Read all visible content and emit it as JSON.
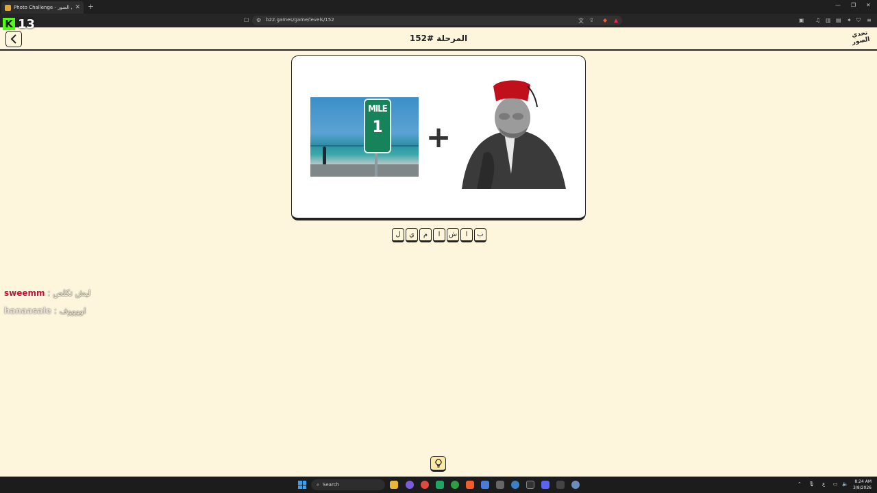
{
  "browser": {
    "tab_title": "Photo Challenge - تحدي الصور",
    "url": "b22.games/game/levels/152"
  },
  "overlay": {
    "kick_count": "13"
  },
  "header": {
    "back_icon": "chevron-left-icon",
    "level_title": "المرحلة #152",
    "logo_text": "تحدي الصور"
  },
  "puzzle": {
    "left_image": "mile-1-sign-beach-photo",
    "left_sign_top": "MILE",
    "left_sign_num": "1",
    "operator": "+",
    "right_image": "man-in-red-fez-photo"
  },
  "answer": {
    "letters": [
      "ب",
      "ا",
      "ش",
      "ا",
      "م",
      "ي",
      "ل"
    ]
  },
  "chat": [
    {
      "user": "sweemm",
      "user_color": "#c8102e",
      "message": "ليش تكلص"
    },
    {
      "user": "hanaasale",
      "user_color": "#d9c9c0",
      "message": "اووووف"
    }
  ],
  "hint_icon": "lightbulb-icon",
  "taskbar": {
    "search_label": "Search",
    "time": "8:24 AM",
    "date": "3/8/2026"
  }
}
